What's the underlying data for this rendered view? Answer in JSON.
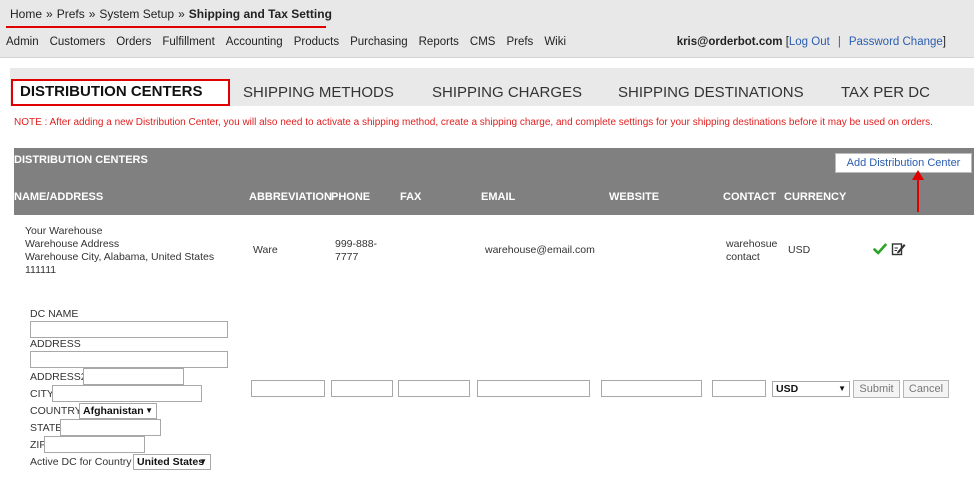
{
  "breadcrumb": {
    "home": "Home",
    "sep": "»",
    "prefs": "Prefs",
    "system_setup": "System Setup",
    "current": "Shipping and Tax Setting"
  },
  "nav": [
    "Admin",
    "Customers",
    "Orders",
    "Fulfillment",
    "Accounting",
    "Products",
    "Purchasing",
    "Reports",
    "CMS",
    "Prefs",
    "Wiki"
  ],
  "user": {
    "email": "kris@orderbot.com",
    "logout": "Log Out",
    "password": "Password Change",
    "open_bracket": "[",
    "close_bracket": "]",
    "sep": "|"
  },
  "tabs": [
    "DISTRIBUTION CENTERS",
    "SHIPPING METHODS",
    "SHIPPING CHARGES",
    "SHIPPING DESTINATIONS",
    "TAX PER DC"
  ],
  "note": "NOTE : After adding a new Distribution Center, you will also need to activate a shipping method, create a shipping charge, and complete settings for your shipping destinations before it may be used on orders.",
  "table": {
    "title": "DISTRIBUTION CENTERS",
    "add_button": "Add Distribution Center",
    "columns": [
      "NAME/ADDRESS",
      "ABBREVIATION",
      "PHONE",
      "FAX",
      "EMAIL",
      "WEBSITE",
      "CONTACT",
      "CURRENCY"
    ],
    "row": {
      "name_lines": [
        "Your Warehouse",
        "Warehouse Address",
        "Warehouse City, Alabama, United States",
        "111111"
      ],
      "abbreviation": "Ware",
      "phone": "999-888-7777",
      "fax": "",
      "email": "warehouse@email.com",
      "website": "",
      "contact": "warehosue contact",
      "currency": "USD"
    }
  },
  "form": {
    "dc_name": "DC NAME",
    "address": "ADDRESS",
    "address2": "ADDRESS2",
    "city": "CITY",
    "country": "COUNTRY",
    "country_value": "Afghanistan",
    "state": "STATE",
    "zip": "ZIP",
    "active_dc": "Active DC for Country",
    "active_dc_value": "United States",
    "currency_value": "USD",
    "submit": "Submit",
    "cancel": "Cancel"
  },
  "colors": {
    "accent_red": "#e00000",
    "link_blue": "#2a5db0",
    "header_gray": "#808080",
    "check_green": "#2aa52a"
  },
  "icons": [
    "check-icon",
    "edit-icon",
    "dropdown-arrow-icon"
  ]
}
